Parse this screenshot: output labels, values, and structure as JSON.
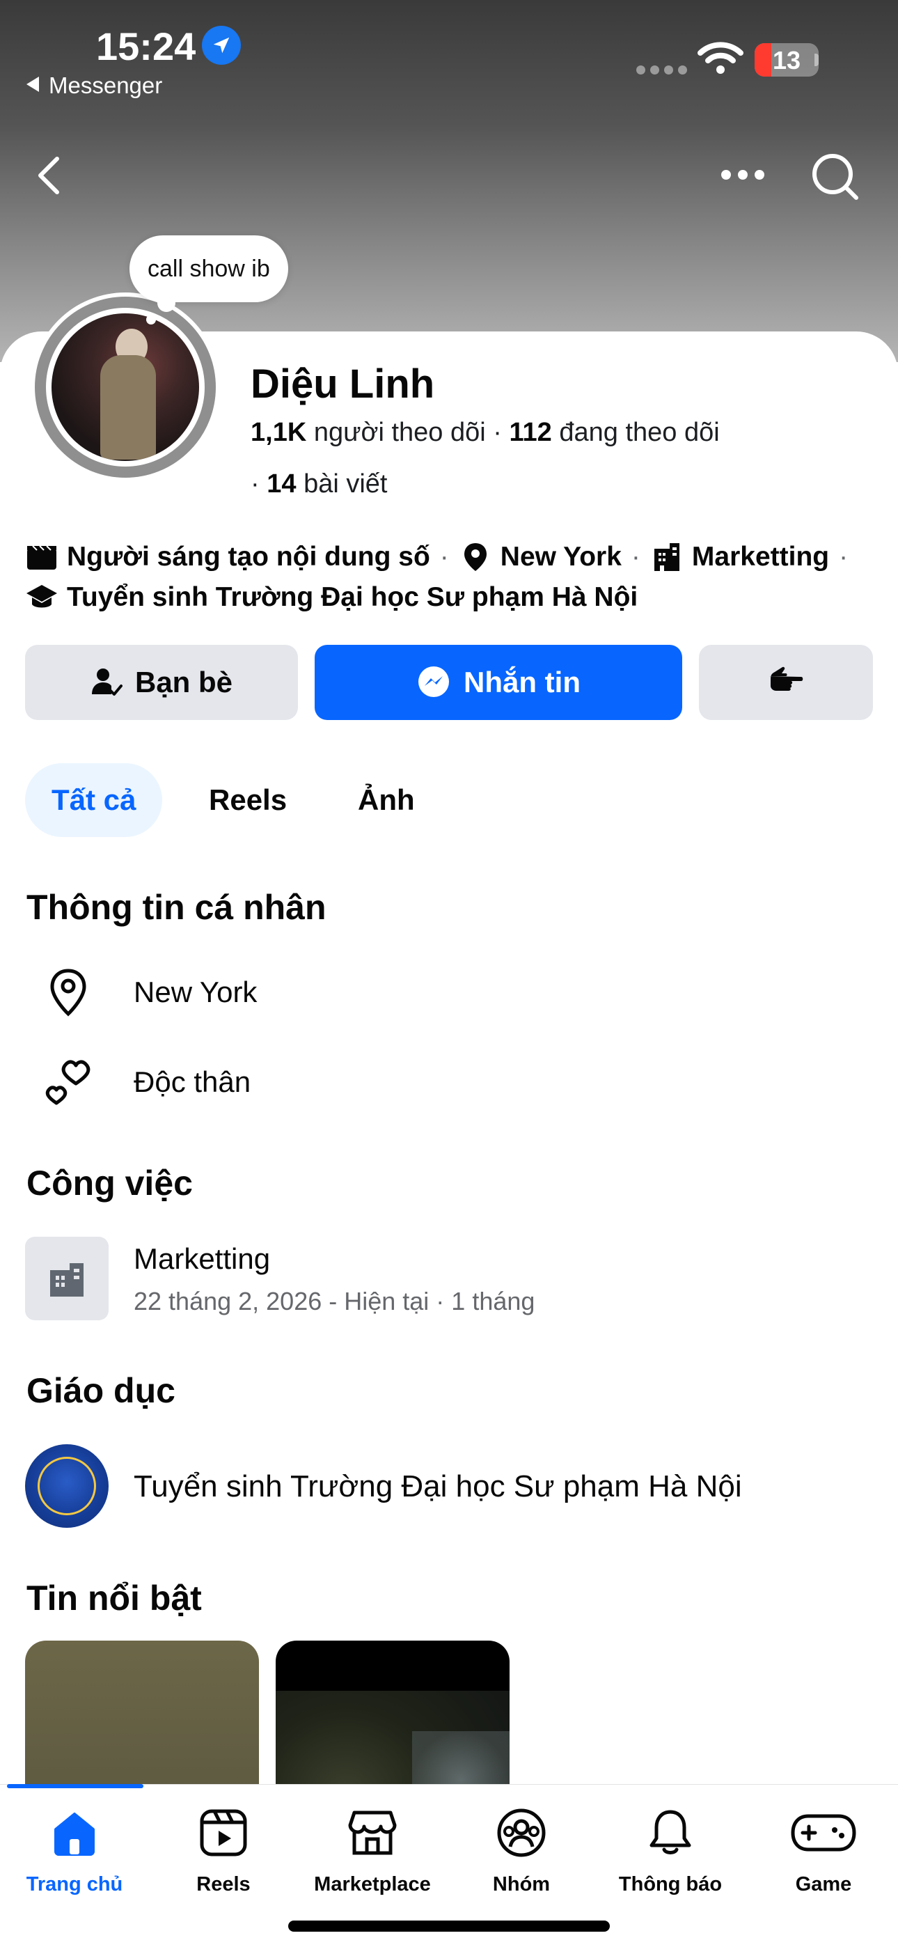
{
  "status_bar": {
    "time": "15:24",
    "back_app": "Messenger",
    "battery": "13",
    "battery_level_percent": 13
  },
  "note": {
    "text": "call show ib"
  },
  "profile": {
    "name": "Diệu Linh",
    "followers_count": "1,1K",
    "followers_label": "người theo dõi",
    "following_count": "112",
    "following_label": "đang theo dõi",
    "posts_count": "14",
    "posts_label": "bài viết"
  },
  "bio": {
    "creator": "Người sáng tạo nội dung số",
    "location": "New York",
    "work": "Marketting",
    "school": "Tuyển sinh Trường Đại học Sư phạm Hà Nội"
  },
  "actions": {
    "friends_label": "Bạn bè",
    "message_label": "Nhắn tin"
  },
  "tabs": [
    {
      "label": "Tất cả",
      "active": true
    },
    {
      "label": "Reels",
      "active": false
    },
    {
      "label": "Ảnh",
      "active": false
    }
  ],
  "personal_info": {
    "title": "Thông tin cá nhân",
    "location": "New York",
    "relationship": "Độc thân"
  },
  "work": {
    "title": "Công việc",
    "position": "Marketting",
    "period": "22 tháng 2, 2026 - Hiện tại · 1 tháng"
  },
  "education": {
    "title": "Giáo dục",
    "school": "Tuyển sinh Trường Đại học Sư phạm Hà Nội"
  },
  "highlights": {
    "title": "Tin nổi bật"
  },
  "bottom_nav": [
    {
      "label": "Trang chủ",
      "icon": "home-icon",
      "active": true
    },
    {
      "label": "Reels",
      "icon": "reels-icon",
      "active": false
    },
    {
      "label": "Marketplace",
      "icon": "marketplace-icon",
      "active": false
    },
    {
      "label": "Nhóm",
      "icon": "groups-icon",
      "active": false
    },
    {
      "label": "Thông báo",
      "icon": "bell-icon",
      "active": false
    },
    {
      "label": "Game",
      "icon": "gamepad-icon",
      "active": false
    }
  ],
  "colors": {
    "accent": "#0866ff",
    "button_grey": "#e4e6eb",
    "tab_active_bg": "#ebf5ff",
    "secondary_text": "#65676b"
  }
}
